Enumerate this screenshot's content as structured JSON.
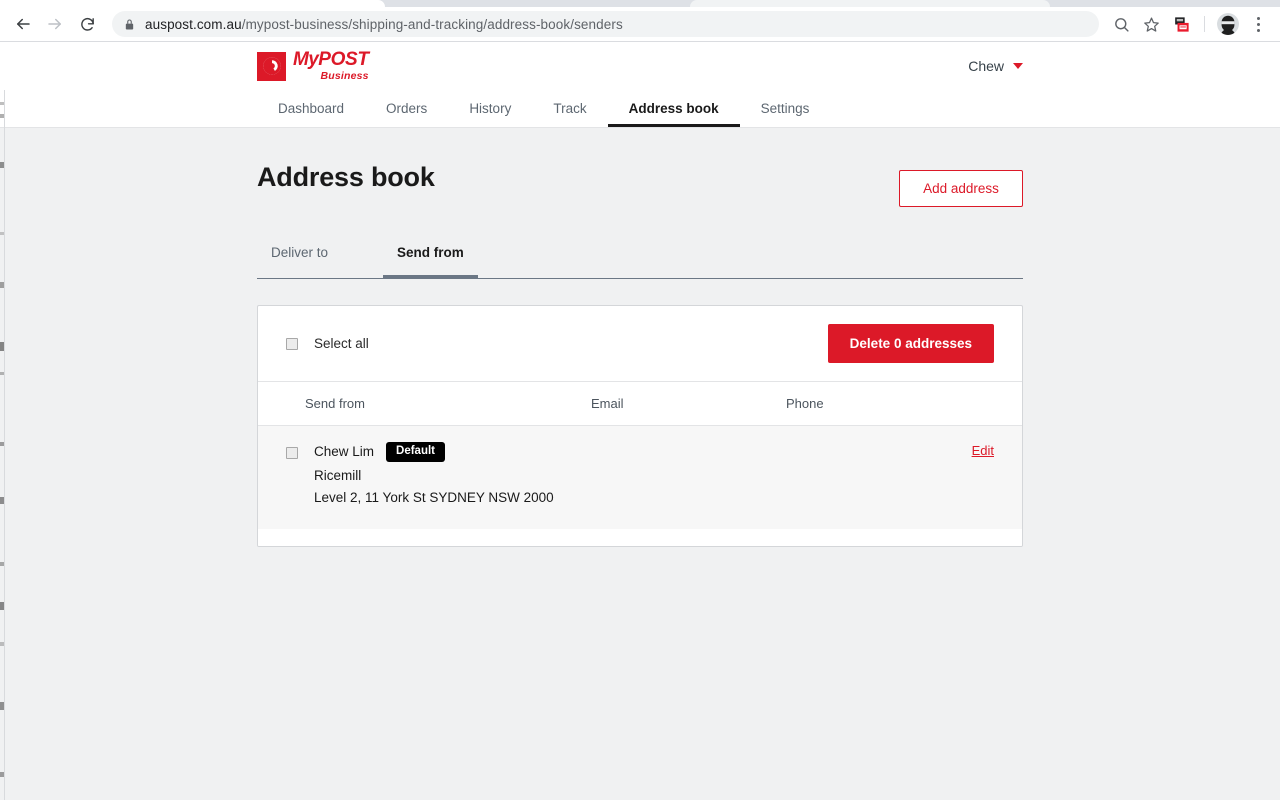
{
  "browser": {
    "url_host": "auspost.com.au",
    "url_path": "/mypost-business/shipping-and-tracking/address-book/senders",
    "back_icon": "back-arrow-icon",
    "forward_icon": "forward-arrow-icon",
    "reload_icon": "reload-icon",
    "lock_icon": "lock-icon",
    "zoom_icon": "search-icon",
    "bookmark_icon": "star-icon",
    "extension_icon": "extension-icon",
    "profile_icon": "profile-avatar-icon",
    "menu_icon": "kebab-menu-icon"
  },
  "header": {
    "logo_line1_my": "My",
    "logo_line1_post": "POST",
    "logo_line2": "Business",
    "logo_mark": "australia-post-p-icon",
    "account_name": "Chew",
    "account_chevron": "chevron-down-icon"
  },
  "nav": {
    "items": [
      {
        "label": "Dashboard",
        "active": false
      },
      {
        "label": "Orders",
        "active": false
      },
      {
        "label": "History",
        "active": false
      },
      {
        "label": "Track",
        "active": false
      },
      {
        "label": "Address book",
        "active": true
      },
      {
        "label": "Settings",
        "active": false
      }
    ]
  },
  "page": {
    "title": "Address book",
    "add_address_label": "Add address"
  },
  "subtabs": [
    {
      "label": "Deliver to",
      "active": false
    },
    {
      "label": "Send from",
      "active": true
    }
  ],
  "toolbar": {
    "select_all_label": "Select all",
    "delete_label": "Delete 0 addresses"
  },
  "table": {
    "columns": [
      "Send from",
      "Email",
      "Phone"
    ],
    "rows": [
      {
        "name": "Chew Lim",
        "badge": "Default",
        "company": "Ricemill",
        "address": "Level 2, 11 York St SYDNEY NSW 2000",
        "email": "",
        "phone": "",
        "edit_label": "Edit"
      }
    ]
  },
  "colors": {
    "brand_red": "#dc1928",
    "page_bg": "#f0f1f2",
    "row_bg": "#f7f7f7",
    "badge_bg": "#000000",
    "tab_underline": "#6b7785"
  }
}
